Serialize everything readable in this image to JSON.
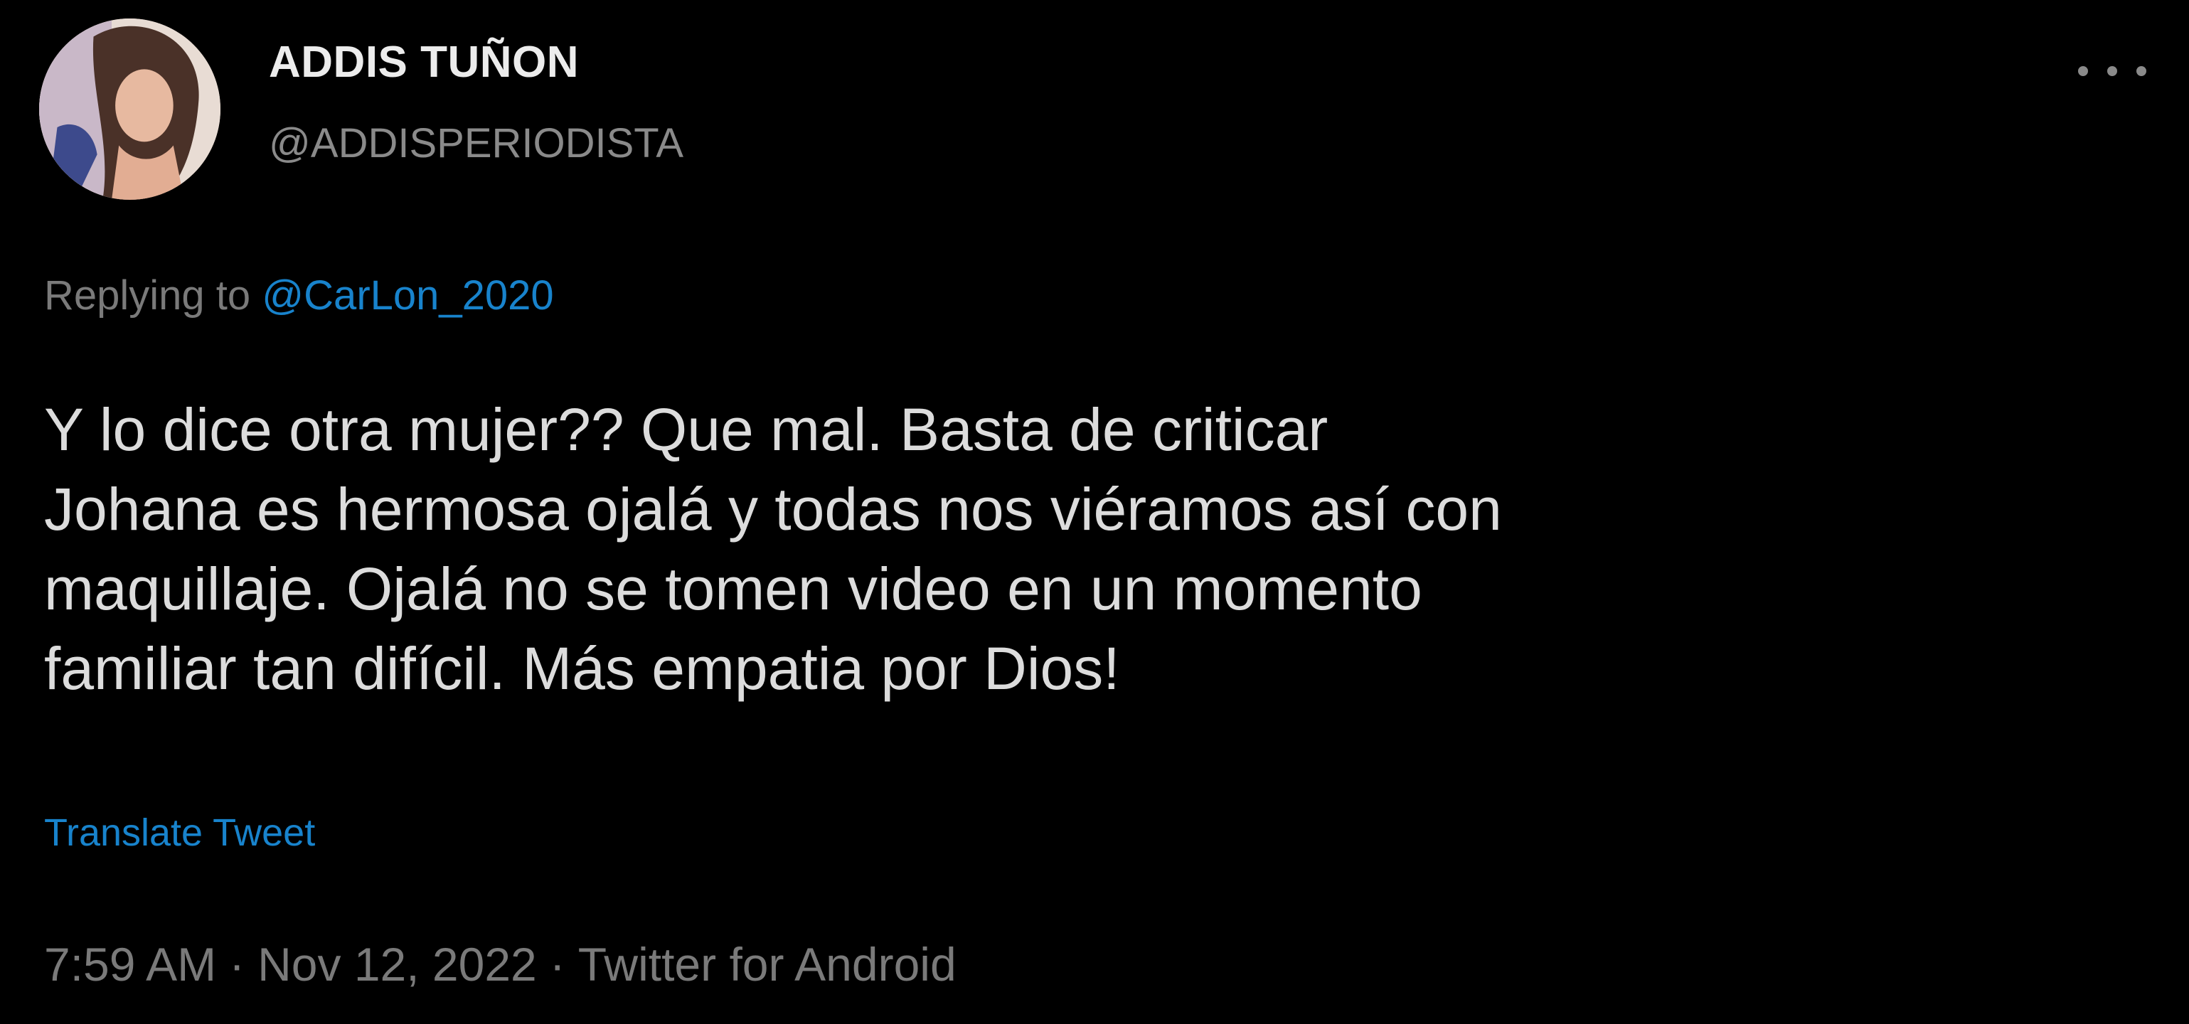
{
  "user": {
    "display_name": "ADDIS TUÑON",
    "handle": "@ADDISPERIODISTA",
    "avatar_icon": "profile-photo"
  },
  "menu": {
    "icon": "more-horizontal-icon"
  },
  "reply": {
    "prefix": "Replying to",
    "mention": "@CarLon_2020"
  },
  "tweet": {
    "lines": [
      "Y lo dice otra mujer?? Que mal. Basta de criticar",
      "Johana es hermosa ojalá y todas nos viéramos así con",
      "maquillaje. Ojalá no se tomen video en un momento",
      "familiar tan difícil. Más empatia por Dios!"
    ],
    "translate_label": "Translate Tweet"
  },
  "meta": {
    "time": "7:59 AM",
    "date": "Nov 12, 2022",
    "source": "Twitter for Android",
    "separator": "·"
  },
  "colors": {
    "background": "#000000",
    "link": "#1d9bf0",
    "secondary_text": "#7a7a7a",
    "primary_text": "#dcdcdc"
  }
}
